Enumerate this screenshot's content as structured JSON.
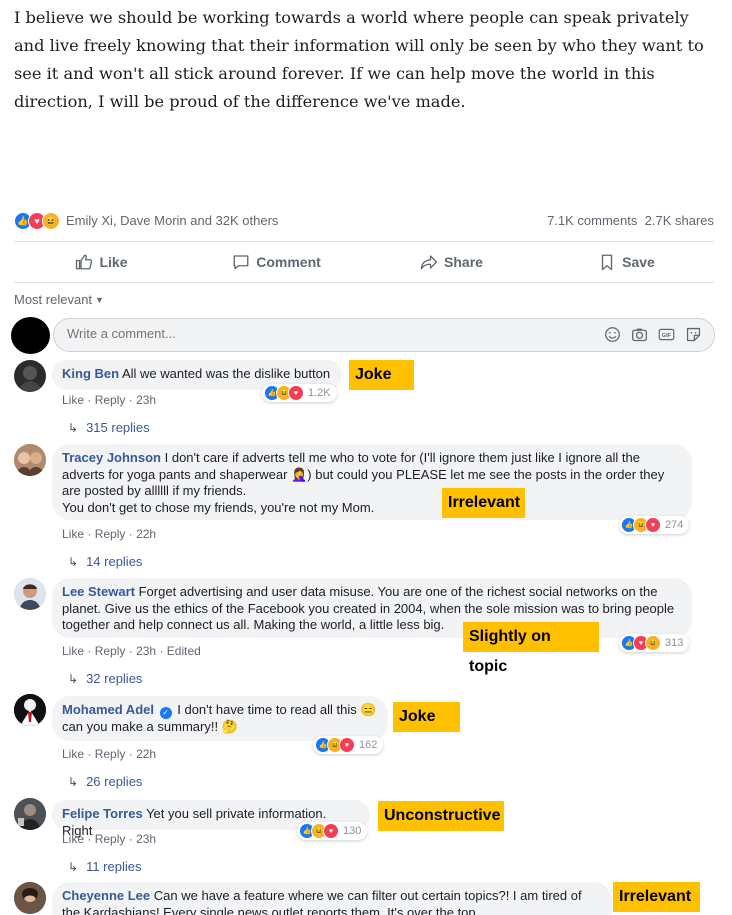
{
  "post": {
    "text": "I believe we should be working towards a world where people can speak privately and live freely knowing that their information will only be seen by who they want to see it and won't all stick around forever. If we can help move the world in this direction, I will be proud of the difference we've made."
  },
  "reactions": {
    "reactors": "Emily Xi, Dave Morin and 32K others",
    "comments": "7.1K comments",
    "shares": "2.7K shares"
  },
  "actions": {
    "like": "Like",
    "comment": "Comment",
    "share": "Share",
    "save": "Save"
  },
  "sort": {
    "label": "Most relevant"
  },
  "composer": {
    "placeholder": "Write a comment..."
  },
  "meta_labels": {
    "like": "Like",
    "reply": "Reply",
    "separator": "·"
  },
  "comments": [
    {
      "author": "King Ben",
      "text": "All we wanted was the dislike button",
      "time": "23h",
      "edited": "",
      "reactions": "1.2K",
      "replies": "315 replies",
      "tag": "Joke"
    },
    {
      "author": "Tracey Johnson",
      "text": "I don't care if adverts tell me who to vote for (I'll ignore them just like I ignore all the adverts for yoga pants and shaperwear 🤦‍♀️) but could you PLEASE let me see the posts in the order they are posted by allllll if my friends.",
      "text2": "You don't get to chose my friends, you're not my Mom.",
      "time": "22h",
      "edited": "",
      "reactions": "274",
      "replies": "14 replies",
      "tag": "Irrelevant"
    },
    {
      "author": "Lee Stewart",
      "text": "Forget advertising and user data misuse. You are one of the richest social networks on the planet. Give us the ethics of the Facebook you created in 2004, when the sole mission was to bring people together and help connect us all. Making the world, a little less big.",
      "time": "23h",
      "edited": "Edited",
      "reactions": "313",
      "replies": "32 replies",
      "tag": "Slightly on topic"
    },
    {
      "author": "Mohamed Adel",
      "text": "I don't have time to read all this 😑",
      "text2": "can you make a summary!! 🤔",
      "time": "22h",
      "edited": "",
      "reactions": "162",
      "replies": "26 replies",
      "tag": "Joke"
    },
    {
      "author": "Felipe Torres",
      "text": "Yet you sell private information. Right",
      "time": "23h",
      "edited": "",
      "reactions": "130",
      "replies": "11 replies",
      "tag": "Unconstructive"
    },
    {
      "author": "Cheyenne Lee",
      "text": "Can we have a feature where we can filter out certain topics?! I am tired of the Kardashians! Every single news outlet reports them. It's over the top",
      "time": "",
      "edited": "",
      "reactions": "",
      "replies": "",
      "tag": "Irrelevant"
    }
  ],
  "colors": {
    "link": "#385898",
    "tag": "#ffc000",
    "bubble": "#f2f3f5",
    "like": "#1877f2",
    "love": "#f33e58",
    "haha": "#f7b125"
  },
  "icons": [
    "like-icon",
    "comment-icon",
    "share-icon",
    "save-icon",
    "smiley-icon",
    "camera-icon",
    "gif-icon",
    "sticker-icon",
    "reply-arrow-icon",
    "verified-icon"
  ]
}
